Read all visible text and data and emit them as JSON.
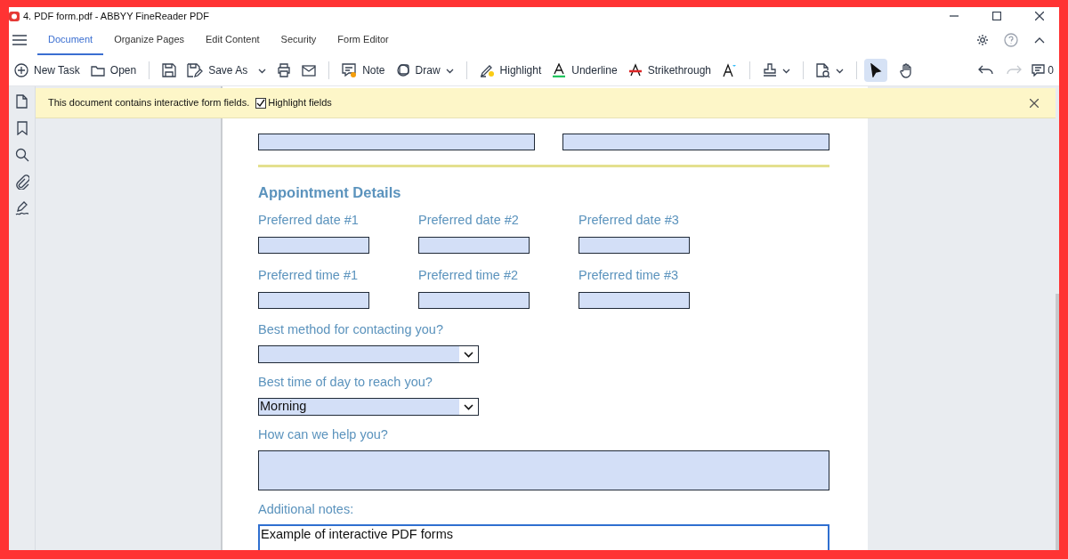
{
  "window": {
    "title": "4. PDF form.pdf - ABBYY FineReader PDF"
  },
  "tabs": [
    {
      "label": "Document",
      "selected": true
    },
    {
      "label": "Organize Pages",
      "selected": false
    },
    {
      "label": "Edit Content",
      "selected": false
    },
    {
      "label": "Security",
      "selected": false
    },
    {
      "label": "Form Editor",
      "selected": false
    }
  ],
  "toolbar": {
    "new_task": "New Task",
    "open": "Open",
    "save_as": "Save As",
    "note": "Note",
    "draw": "Draw",
    "highlight": "Highlight",
    "underline": "Underline",
    "strikethrough": "Strikethrough",
    "comment_count": "0"
  },
  "tools": [
    {
      "selected": true
    },
    {
      "selected": false
    }
  ],
  "banner": {
    "message": "This document contains interactive form fields.",
    "checkbox": {
      "label": "Highlight fields",
      "checked": true
    }
  },
  "form": {
    "contact_fields": [
      {
        "kind": "text"
      },
      {
        "kind": "text"
      }
    ],
    "heading": "Appointment Details",
    "date_fields": [
      {
        "label": "Preferred date #1"
      },
      {
        "label": "Preferred date #2"
      },
      {
        "label": "Preferred date #3"
      }
    ],
    "time_fields": [
      {
        "label": "Preferred time #1"
      },
      {
        "label": "Preferred time #2"
      },
      {
        "label": "Preferred time #3"
      }
    ],
    "contact_method": {
      "label": "Best method for contacting you?"
    },
    "best_time": {
      "label": "Best time of day to reach you?",
      "value": "Morning"
    },
    "help": {
      "label": "How can we help you?"
    },
    "notes": {
      "label": "Additional notes:",
      "value": "Example of interactive PDF forms",
      "focused": true
    }
  }
}
